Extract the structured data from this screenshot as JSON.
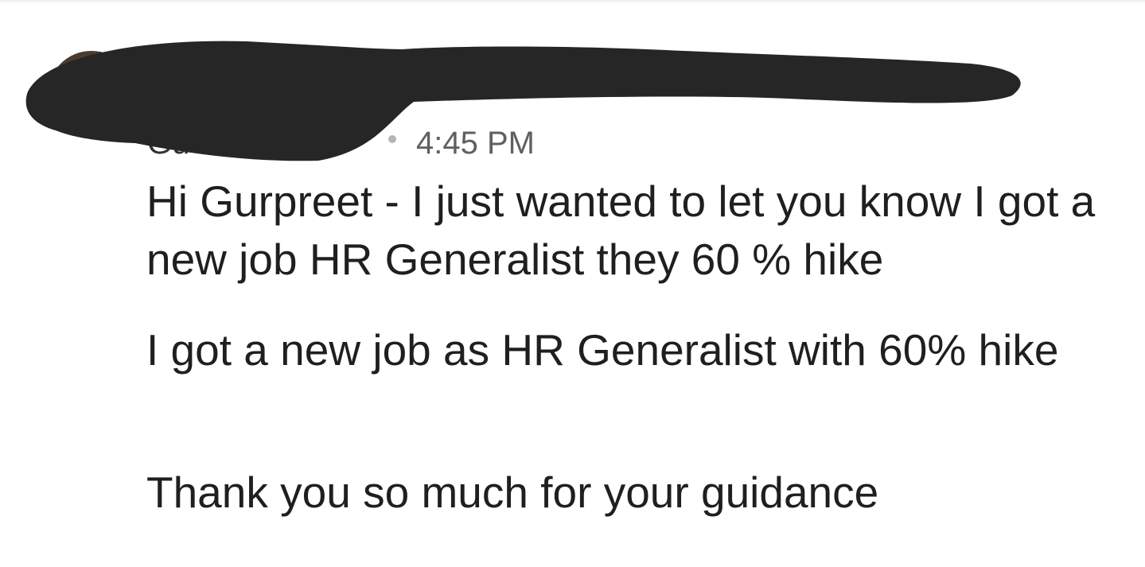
{
  "message": {
    "sender_name": "Gu",
    "timestamp": "4:45 PM",
    "paragraphs": [
      "Hi Gurpreet - I just wanted to let you know I got a new job HR Generalist they 60 % hike",
      "I got a new job as HR Generalist with 60% hike",
      "Thank you so much for your guidance"
    ]
  },
  "colors": {
    "background": "#ffffff",
    "body_text": "#1f1f1f",
    "timestamp": "#5f5f5f",
    "redaction": "#262626"
  },
  "icons": {
    "avatar": "profile-avatar-icon"
  }
}
